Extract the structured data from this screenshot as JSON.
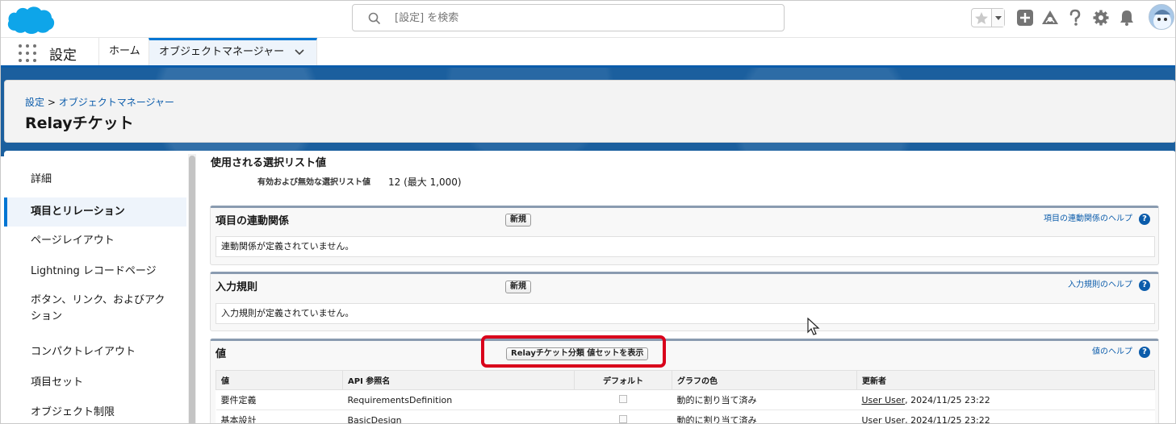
{
  "header": {
    "search_placeholder": "[設定] を検索",
    "icons": [
      "cloud-logo",
      "search-icon",
      "star-icon",
      "chevron-down-icon",
      "plus-icon",
      "trailhead-icon",
      "help-icon",
      "gear-icon",
      "bell-icon",
      "avatar"
    ]
  },
  "nav": {
    "app_name": "設定",
    "tabs": [
      {
        "label": "ホーム"
      },
      {
        "label": "オブジェクトマネージャー",
        "active": true
      }
    ]
  },
  "page": {
    "breadcrumb_root": "設定",
    "breadcrumb_sep": " > ",
    "breadcrumb_current": "オブジェクトマネージャー",
    "title": "Relayチケット"
  },
  "sidebar": {
    "items": [
      {
        "label": "詳細"
      },
      {
        "label": "項目とリレーション",
        "active": true
      },
      {
        "label": "ページレイアウト"
      },
      {
        "label": "Lightning レコードページ"
      },
      {
        "label": "ボタン、リンク、およびアクション"
      },
      {
        "label": "コンパクトレイアウト"
      },
      {
        "label": "項目セット"
      },
      {
        "label": "オブジェクト制限"
      }
    ]
  },
  "picklist": {
    "title": "使用される選択リスト値",
    "label": "有効および無効な選択リスト値",
    "value": "12 (最大 1,000)"
  },
  "sections": {
    "dependency": {
      "title": "項目の連動関係",
      "button": "新規",
      "help": "項目の連動関係のヘルプ",
      "empty": "連動関係が定義されていません。"
    },
    "validation": {
      "title": "入力規則",
      "button": "新規",
      "help": "入力規則のヘルプ",
      "empty": "入力規則が定義されていません。"
    },
    "values": {
      "title": "値",
      "button": "Relayチケット分類 値セットを表示",
      "help": "値のヘルプ"
    }
  },
  "help_q": "?",
  "values_table": {
    "columns": [
      "値",
      "API 参照名",
      "デフォルト",
      "グラフの色",
      "更新者"
    ],
    "rows": [
      {
        "value": "要件定義",
        "api": "RequirementsDefinition",
        "color": "動的に割り当て済み",
        "user": "User User",
        "date": ", 2024/11/25 23:22"
      },
      {
        "value": "基本設計",
        "api": "BasicDesign",
        "color": "動的に割り当て済み",
        "user": "User User",
        "date": ", 2024/11/25 23:22"
      }
    ]
  },
  "colors": {
    "brand": "#0176d3",
    "highlight": "#d9001b",
    "band": "#1b5f9e"
  }
}
